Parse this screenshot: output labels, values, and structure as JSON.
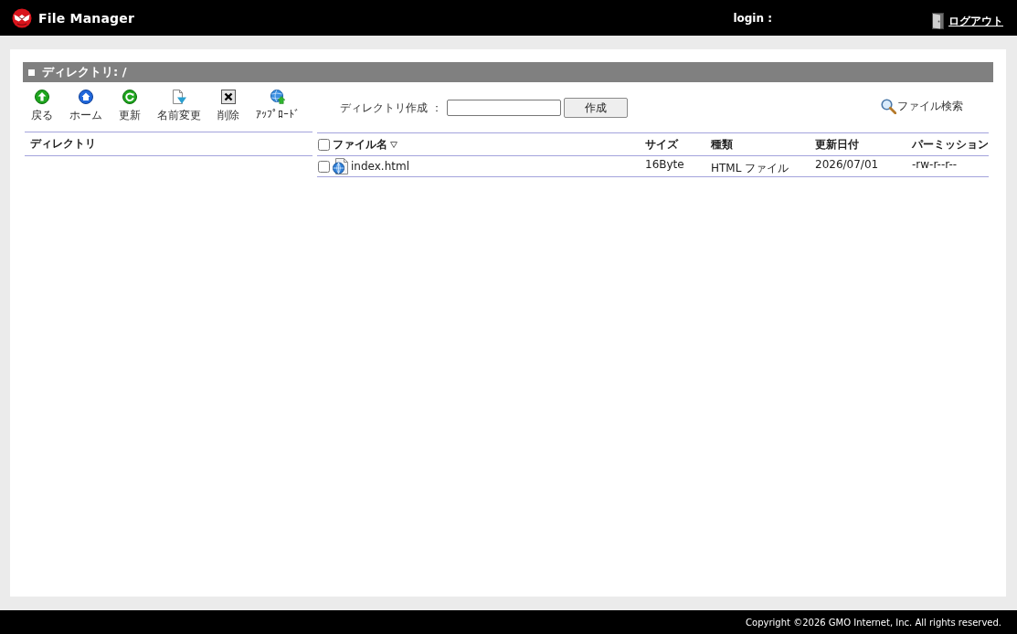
{
  "header": {
    "app_name": "File Manager",
    "login_label": "login :",
    "logout_link": "ログアウト"
  },
  "panel_title": "ディレクトリ: /",
  "toolbar": [
    {
      "kind": "back",
      "label": "戻る"
    },
    {
      "kind": "home",
      "label": "ホーム"
    },
    {
      "kind": "refresh",
      "label": "更新"
    },
    {
      "kind": "rename",
      "label": "名前変更"
    },
    {
      "kind": "delete",
      "label": "削除"
    },
    {
      "kind": "upload",
      "label": "ｱｯﾌﾟﾛｰﾄﾞ"
    }
  ],
  "create_directory": {
    "label": "ディレクトリ作成 ：",
    "button": "作成"
  },
  "search_link": "ファイル検索",
  "directory_tree": {
    "heading": "ディレクトリ"
  },
  "file_table": {
    "select_all": {
      "checked": false
    },
    "columns": [
      {
        "label": "ファイル名",
        "sorted": true
      },
      {
        "label": "サイズ",
        "sorted": false
      },
      {
        "label": "種類",
        "sorted": false
      },
      {
        "label": "更新日付",
        "sorted": false
      },
      {
        "label": "パーミッション",
        "sorted": false
      }
    ],
    "rows": [
      {
        "checked": false,
        "name": "index.html",
        "size": "16Byte",
        "type": "HTML ファイル",
        "modified": "2026/07/01",
        "permissions": "-rw-r--r--"
      }
    ]
  },
  "footer": {
    "copyright": "Copyright ©2026 GMO Internet, Inc. All rights reserved."
  }
}
